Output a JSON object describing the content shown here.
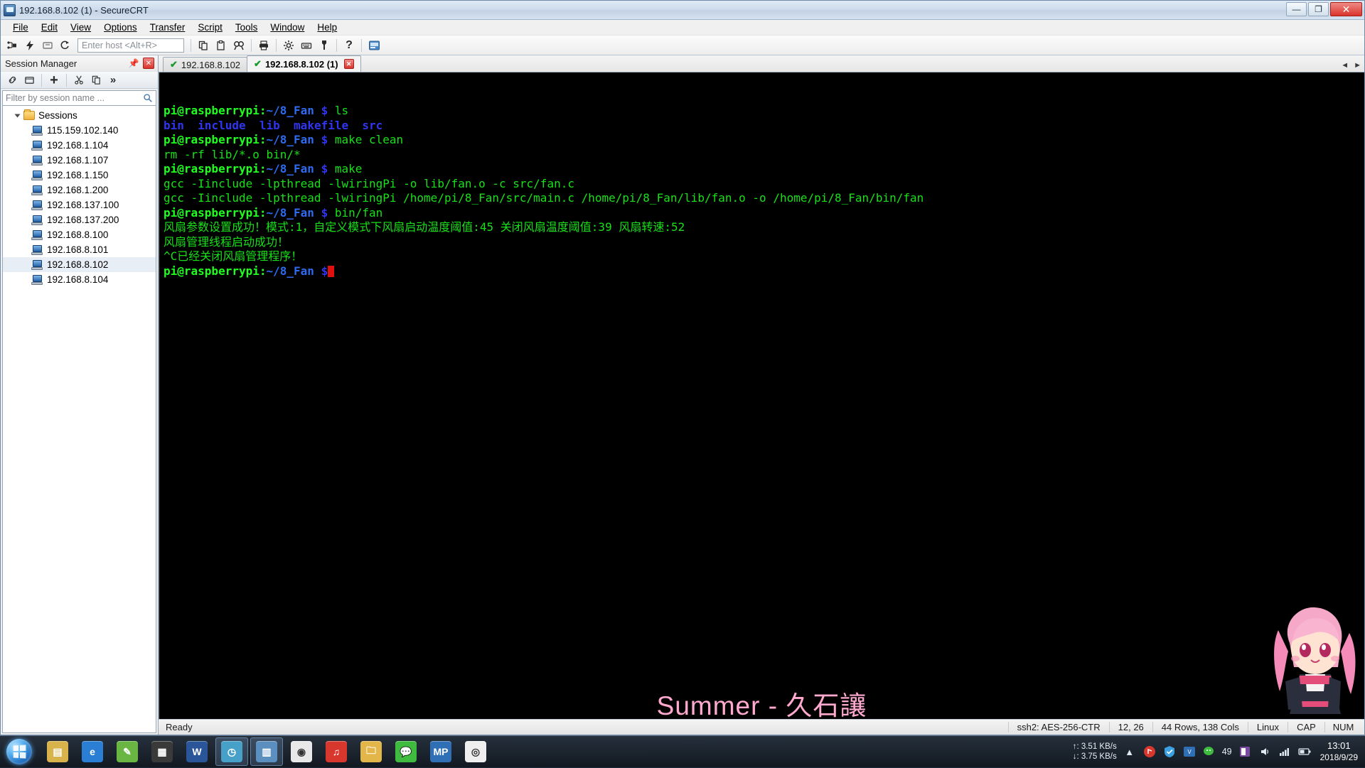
{
  "window": {
    "title": "192.168.8.102 (1) - SecureCRT",
    "icon": "securecrt-icon",
    "minimize": "—",
    "maximize": "❐",
    "close": "✕"
  },
  "menu": {
    "items": [
      {
        "label": "File",
        "mnemonic": "F"
      },
      {
        "label": "Edit",
        "mnemonic": "E"
      },
      {
        "label": "View",
        "mnemonic": "V"
      },
      {
        "label": "Options",
        "mnemonic": "O"
      },
      {
        "label": "Transfer",
        "mnemonic": "T"
      },
      {
        "label": "Script",
        "mnemonic": "S"
      },
      {
        "label": "Tools",
        "mnemonic": "l"
      },
      {
        "label": "Window",
        "mnemonic": "W"
      },
      {
        "label": "Help",
        "mnemonic": "H"
      }
    ]
  },
  "toolbar": {
    "host_placeholder": "Enter host <Alt+R>",
    "host_value": "",
    "icons": [
      "connect-icon",
      "quick-connect-icon",
      "connect-in-tab-icon",
      "reconnect-icon",
      "copy-icon",
      "paste-icon",
      "find-icon",
      "print-icon",
      "session-options-icon",
      "keymap-editor-icon",
      "color-scheme-icon",
      "help-icon",
      "chat-window-icon"
    ]
  },
  "session_manager": {
    "title": "Session Manager",
    "pin_icon": "pin-icon",
    "close_icon": "close-icon",
    "toolbar_icons": [
      "connect-icon",
      "new-folder-icon",
      "new-session-icon",
      "cut-icon",
      "copy-icon",
      "more-icon"
    ],
    "filter_placeholder": "Filter by session name ...",
    "filter_value": "",
    "search_icon": "search-icon",
    "root": "Sessions",
    "sessions": [
      "115.159.102.140",
      "192.168.1.104",
      "192.168.1.107",
      "192.168.1.150",
      "192.168.1.200",
      "192.168.137.100",
      "192.168.137.200",
      "192.168.8.100",
      "192.168.8.101",
      "192.168.8.102",
      "192.168.8.104"
    ],
    "selected_index": 9
  },
  "tabs": [
    {
      "label": "192.168.8.102",
      "active": false,
      "connected": true,
      "closable": false
    },
    {
      "label": "192.168.8.102 (1)",
      "active": true,
      "connected": true,
      "closable": true
    }
  ],
  "tab_nav": {
    "left": "◄",
    "right": "►"
  },
  "terminal": {
    "prompt_user": "pi@raspberrypi",
    "prompt_sep": ":",
    "prompt_path": "~/8_Fan",
    "prompt_dollar": "$",
    "lines": [
      {
        "type": "prompt",
        "command": " ls"
      },
      {
        "type": "ls",
        "entries": [
          "bin",
          "include",
          "lib",
          "makefile",
          "src"
        ]
      },
      {
        "type": "prompt",
        "command": " make clean"
      },
      {
        "type": "out",
        "text": "rm -rf lib/*.o bin/*"
      },
      {
        "type": "prompt",
        "command": " make"
      },
      {
        "type": "out",
        "text": "gcc -Iinclude -lpthread -lwiringPi -o lib/fan.o -c src/fan.c"
      },
      {
        "type": "out",
        "text": "gcc -Iinclude -lpthread -lwiringPi /home/pi/8_Fan/src/main.c /home/pi/8_Fan/lib/fan.o -o /home/pi/8_Fan/bin/fan"
      },
      {
        "type": "prompt",
        "command": " bin/fan"
      },
      {
        "type": "out",
        "text": "风扇参数设置成功！模式:1，自定义模式下风扇启动温度阈值:45 关闭风扇温度阈值:39 风扇转速:52"
      },
      {
        "type": "out",
        "text": "风扇管理线程启动成功！"
      },
      {
        "type": "out",
        "text": "^C已经关闭风扇管理程序！"
      },
      {
        "type": "prompt",
        "command": ""
      }
    ],
    "cursor": "block",
    "watermark": "Summer - 久石讓",
    "colors": {
      "background": "#000000",
      "green": "#18e018",
      "prompt_green": "#1fff1f",
      "blue": "#2f35f0",
      "cursor_red": "#e01010",
      "watermark_pink": "#ffa9cf"
    }
  },
  "statusbar": {
    "ready": "Ready",
    "cipher": "ssh2: AES-256-CTR",
    "position": "12, 26",
    "dimensions": "44 Rows, 138 Cols",
    "platform": "Linux",
    "caps": "CAP",
    "num": "NUM"
  },
  "taskbar": {
    "start_icon": "windows-start-orb",
    "apps": [
      {
        "name": "file-explorer",
        "glyph": "▤",
        "color": "#d8b24a",
        "running": false
      },
      {
        "name": "internet-explorer",
        "glyph": "e",
        "color": "#2a7fd4",
        "running": false
      },
      {
        "name": "notepad-plus-plus",
        "glyph": "✎",
        "color": "#69b643",
        "running": false
      },
      {
        "name": "media-player",
        "glyph": "▦",
        "color": "#3a3a3a",
        "running": false
      },
      {
        "name": "microsoft-word",
        "glyph": "W",
        "color": "#2a5699",
        "running": false
      },
      {
        "name": "clock-app",
        "glyph": "◷",
        "color": "#46a0c8",
        "running": true
      },
      {
        "name": "securecrt",
        "glyph": "▥",
        "color": "#5a8fc0",
        "running": true
      },
      {
        "name": "google-chrome",
        "glyph": "◉",
        "color": "#e8e8e8",
        "running": false
      },
      {
        "name": "netease-music",
        "glyph": "♫",
        "color": "#d8372e",
        "running": false
      },
      {
        "name": "folder-window",
        "glyph": "🗀",
        "color": "#e3b64a",
        "running": false
      },
      {
        "name": "wechat",
        "glyph": "💬",
        "color": "#3fbb3f",
        "running": false
      },
      {
        "name": "mp-app",
        "glyph": "MP",
        "color": "#2f6fb5",
        "running": false
      },
      {
        "name": "opencv-app",
        "glyph": "◎",
        "color": "#efefef",
        "running": false
      }
    ],
    "network": {
      "upload": "↑: 3.51 KB/s",
      "download": "↓: 3.75 KB/s"
    },
    "tray_icons": [
      "show-hidden-icon",
      "netease-icon",
      "security-shield-icon",
      "vpn-icon",
      "wechat-tray-icon",
      "battery-saver-icon",
      "onenote-icon",
      "volume-icon",
      "network-icon",
      "battery-icon"
    ],
    "battery_percent": "49",
    "clock_time": "13:01",
    "clock_date": "2018/9/29",
    "show_desktop": "show-desktop-button"
  }
}
